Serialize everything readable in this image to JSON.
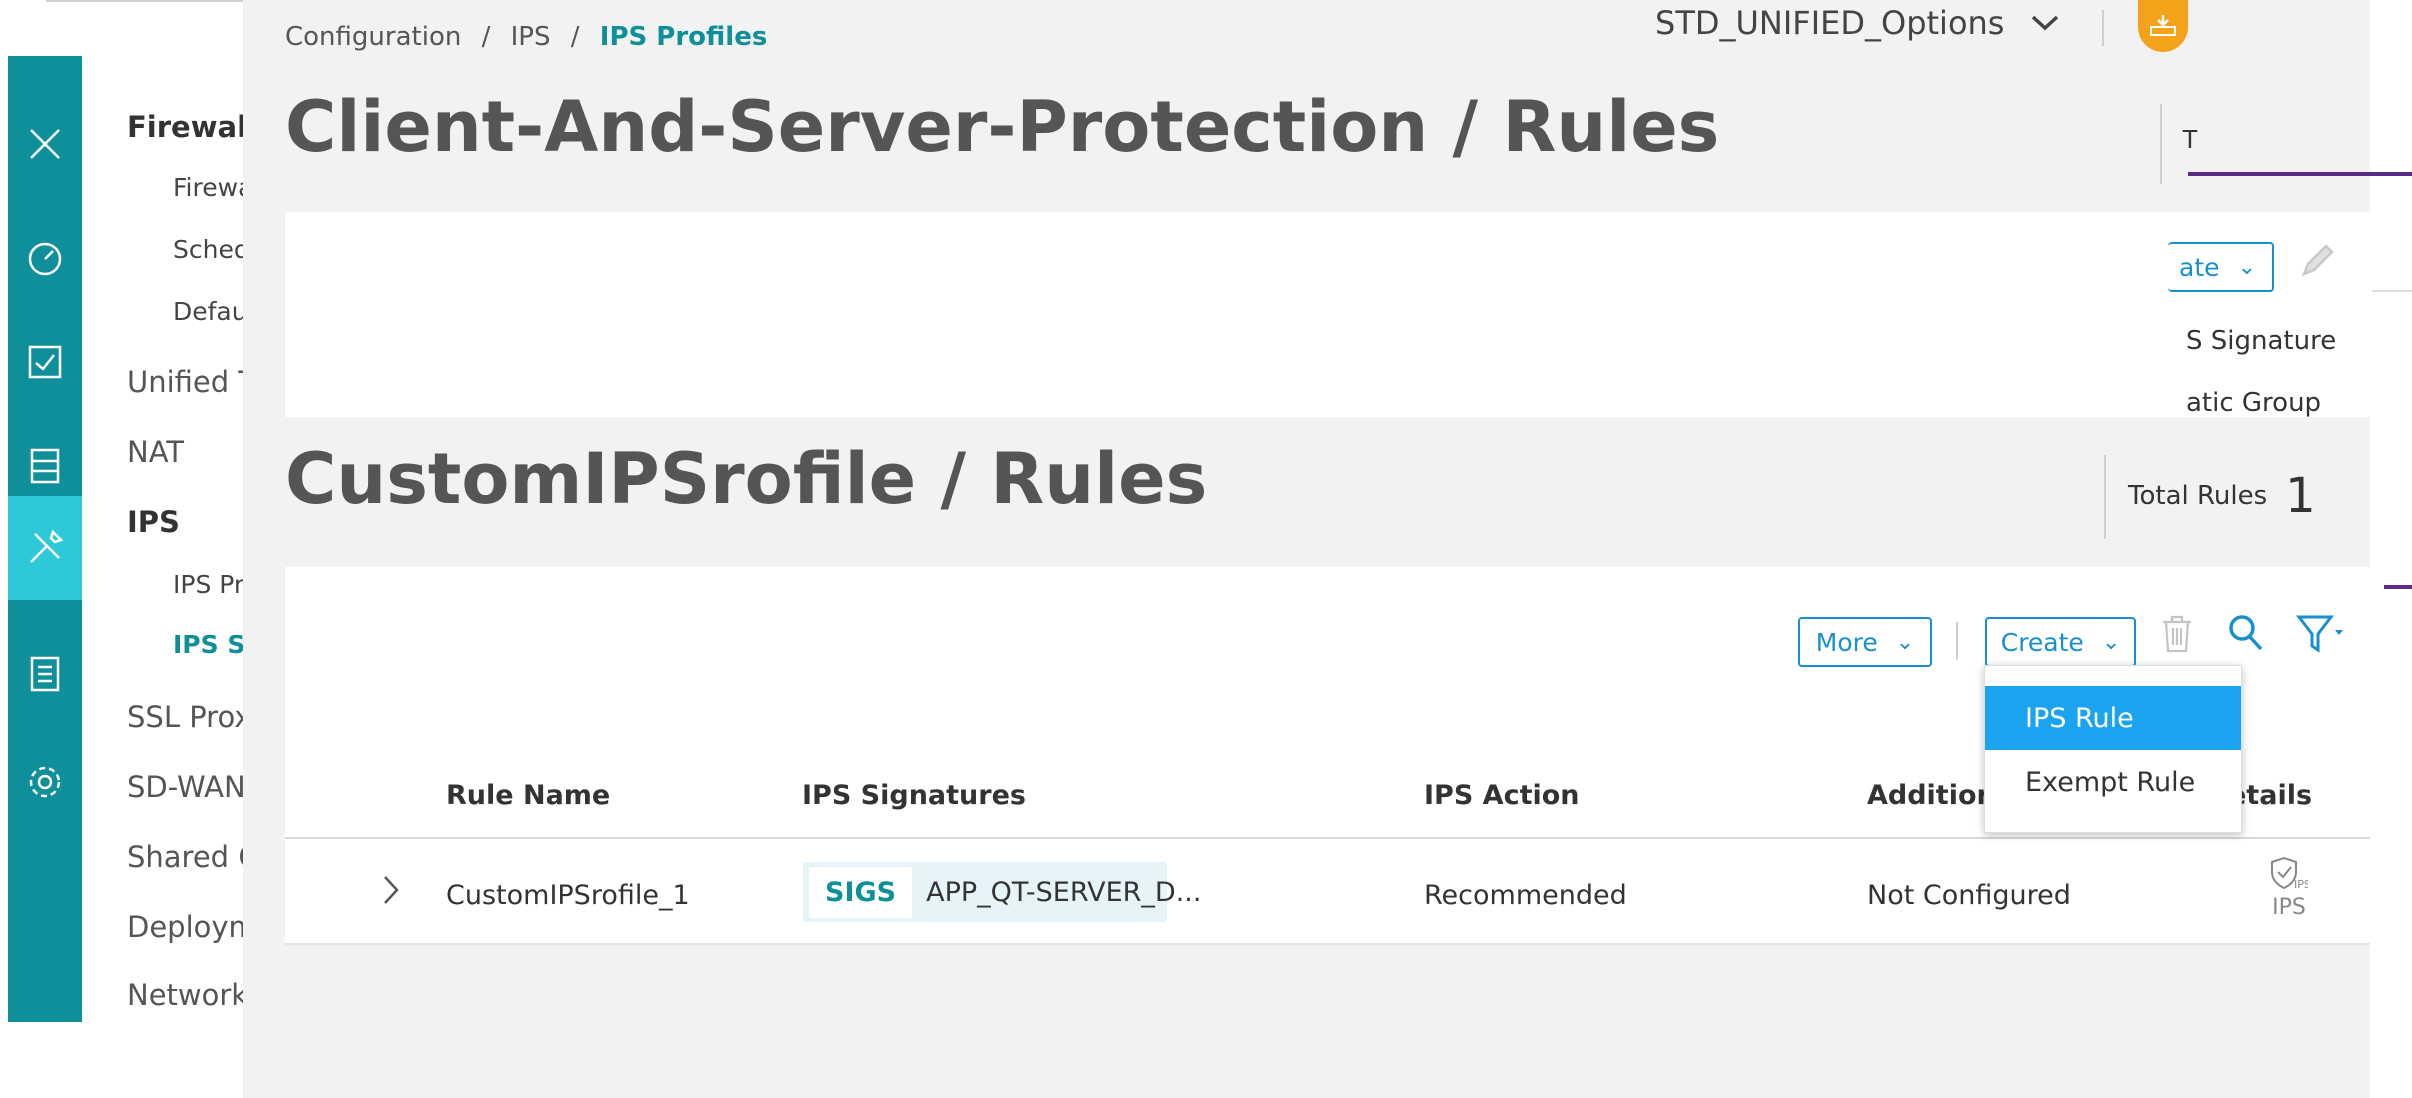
{
  "sidebar": {
    "items": [
      {
        "label": "Firewall",
        "style": "bold"
      },
      {
        "label": "Firewa",
        "style": "sub"
      },
      {
        "label": "Sched",
        "style": "sub"
      },
      {
        "label": "Defau",
        "style": "sub"
      },
      {
        "label": "Unified T",
        "style": "normal"
      },
      {
        "label": "NAT",
        "style": "normal"
      },
      {
        "label": "IPS",
        "style": "bold"
      },
      {
        "label": "IPS Pr",
        "style": "sub"
      },
      {
        "label": "IPS Sig",
        "style": "active"
      },
      {
        "label": "SSL Prox",
        "style": "normal"
      },
      {
        "label": "SD-WAN",
        "style": "normal"
      },
      {
        "label": "Shared C",
        "style": "normal"
      },
      {
        "label": "Deploym",
        "style": "normal"
      },
      {
        "label": "Network",
        "style": "normal"
      }
    ]
  },
  "header": {
    "breadcrumb": {
      "part1": "Configuration",
      "sep": "/",
      "part2": "IPS",
      "current": "IPS Profiles"
    },
    "domain_select": "STD_UNIFIED_Options"
  },
  "back_dialog": {
    "title": "Client-And-Server-Protection / Rules",
    "total_fragment": "T",
    "create_label_fragment": "ate",
    "menu_fragment_1": "S Signature",
    "menu_fragment_2": "atic Group"
  },
  "front_dialog": {
    "title": "CustomIPSrofile / Rules",
    "total_rules_label": "Total Rules",
    "total_rules_value": "1",
    "toolbar": {
      "more_label": "More",
      "create_label": "Create"
    },
    "create_menu": {
      "items": [
        "IPS Rule",
        "Exempt Rule"
      ],
      "selected": "IPS Rule"
    },
    "table": {
      "columns": [
        "Rule Name",
        "IPS Signatures",
        "IPS Action",
        "Additiona",
        "etails"
      ],
      "rows": [
        {
          "rule_name": "CustomIPSrofile_1",
          "sig_tag": "SIGS",
          "sig_text": "APP_QT-SERVER_D...",
          "action": "Recommended",
          "additional": "Not Configured",
          "details_label": "IPS"
        }
      ]
    }
  },
  "colors": {
    "accent": "#0f8f99",
    "link": "#1a8fd0",
    "menu_selected": "#1aa3ee",
    "rail": "#0f8f99",
    "rail_active": "#2ec8d8",
    "purple": "#5b2a86"
  }
}
